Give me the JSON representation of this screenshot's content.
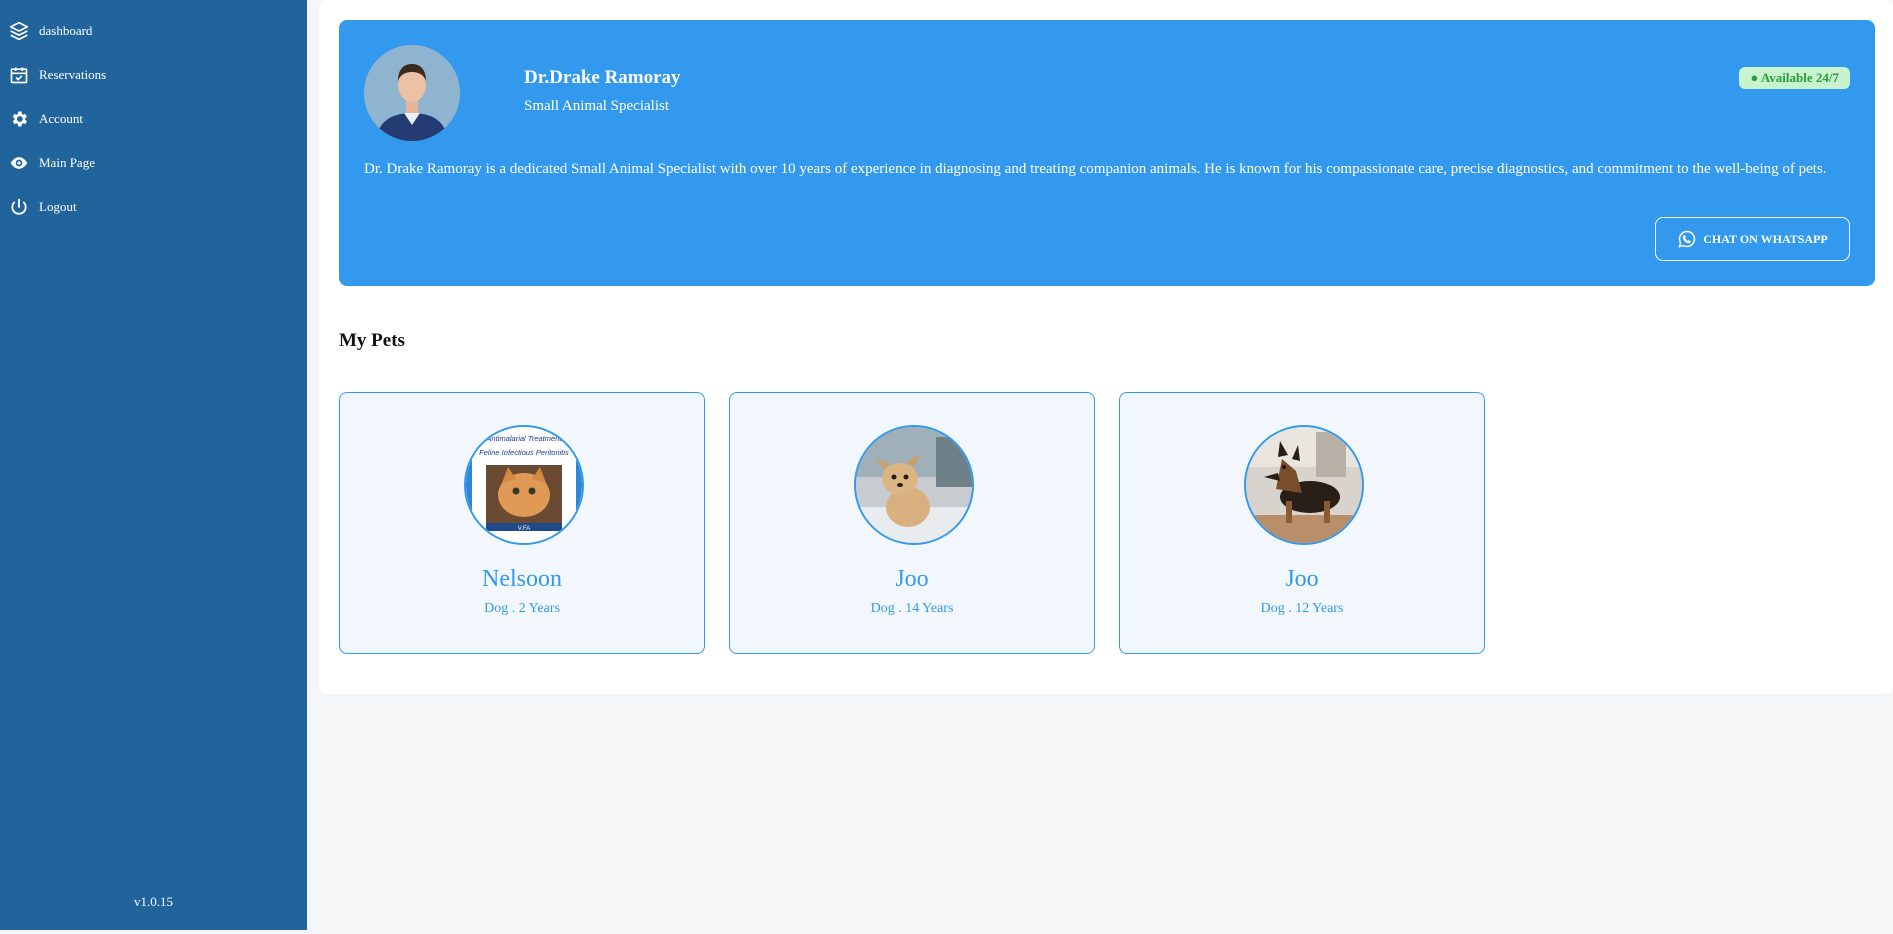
{
  "sidebar": {
    "items": [
      {
        "label": "dashboard",
        "icon": "layers-icon"
      },
      {
        "label": "Reservations",
        "icon": "calendar-check-icon"
      },
      {
        "label": "Account",
        "icon": "gear-icon"
      },
      {
        "label": "Main Page",
        "icon": "eye-icon"
      },
      {
        "label": "Logout",
        "icon": "power-icon"
      }
    ],
    "version": "v1.0.15"
  },
  "doctor": {
    "name": "Dr.Drake Ramoray",
    "title": "Small Animal Specialist",
    "status": "● Available 24/7",
    "bio": "Dr. Drake Ramoray is a dedicated Small Animal Specialist with over 10 years of experience in diagnosing and treating companion animals. He is known for his compassionate care, precise diagnostics, and commitment to the well-being of pets.",
    "whatsapp_label": "CHAT ON WHATSAPP"
  },
  "pets_section": {
    "title": "My Pets",
    "pets": [
      {
        "name": "Nelsoon",
        "meta": "Dog . 2 Years",
        "photo_text_1": "Antimalarial Treatment",
        "photo_text_2": "Feline Infectious Peritonitis",
        "photo_text_3": "V.FA"
      },
      {
        "name": "Joo",
        "meta": "Dog . 14 Years"
      },
      {
        "name": "Joo",
        "meta": "Dog . 12 Years"
      }
    ]
  },
  "colors": {
    "sidebar": "#21649c",
    "accent": "#3399ee",
    "badge_bg": "#c8f3cf",
    "badge_text": "#2e9a3f"
  }
}
